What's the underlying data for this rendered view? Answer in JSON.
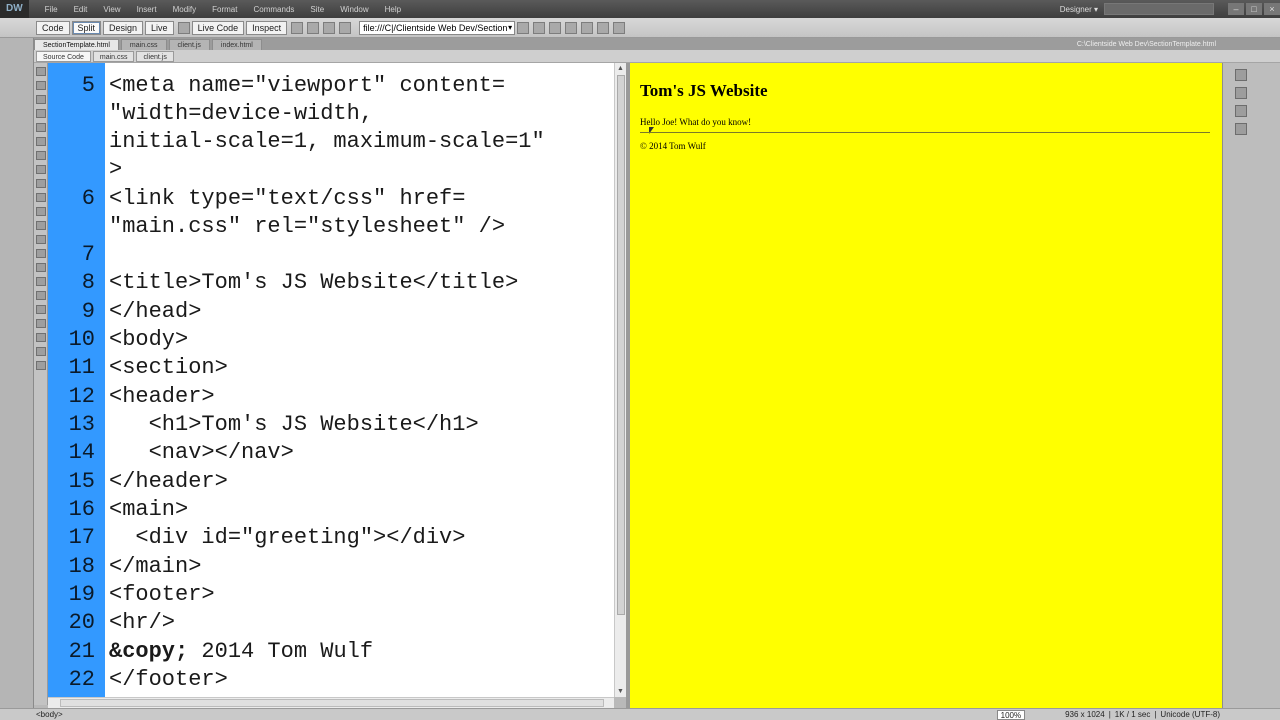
{
  "menubar": {
    "logo": "DW",
    "items": [
      "File",
      "Edit",
      "View",
      "Insert",
      "Modify",
      "Format",
      "Commands",
      "Site",
      "Window",
      "Help"
    ],
    "workspace": "Designer ▾"
  },
  "doc_toolbar": {
    "code_label": "Code",
    "split_label": "Split",
    "design_label": "Design",
    "live_label": "Live",
    "live_code_label": "Live Code",
    "inspect_label": "Inspect",
    "address": "file:///C|/Clientside Web Dev/Section"
  },
  "tabs": [
    {
      "label": "SectionTemplate.html"
    },
    {
      "label": "main.css"
    },
    {
      "label": "client.js"
    },
    {
      "label": "index.html"
    }
  ],
  "file_path": "C:\\Clientside Web Dev\\SectionTemplate.html",
  "related_files": [
    "Source Code",
    "main.css",
    "client.js"
  ],
  "code_lines": [
    {
      "num": "5",
      "text": "<meta name=\"viewport\" content="
    },
    {
      "num": "",
      "text": "\"width=device-width,"
    },
    {
      "num": "",
      "text": "initial-scale=1, maximum-scale=1\""
    },
    {
      "num": "",
      "text": ">"
    },
    {
      "num": "6",
      "text": "<link type=\"text/css\" href="
    },
    {
      "num": "",
      "text": "\"main.css\" rel=\"stylesheet\" />"
    },
    {
      "num": "7",
      "text": ""
    },
    {
      "num": "8",
      "text": "<title>Tom's JS Website</title>"
    },
    {
      "num": "9",
      "text": "</head>"
    },
    {
      "num": "10",
      "text": "<body>"
    },
    {
      "num": "11",
      "text": "<section>"
    },
    {
      "num": "12",
      "text": "<header>"
    },
    {
      "num": "13",
      "text": "   <h1>Tom's JS Website</h1>"
    },
    {
      "num": "14",
      "text": "   <nav></nav>"
    },
    {
      "num": "15",
      "text": "</header>"
    },
    {
      "num": "16",
      "text": "<main>"
    },
    {
      "num": "17",
      "text": "  <div id=\"greeting\"></div>"
    },
    {
      "num": "18",
      "text": "</main>"
    },
    {
      "num": "19",
      "text": "<footer>"
    },
    {
      "num": "20",
      "text": "<hr/>"
    },
    {
      "num": "21",
      "entity": "&copy;",
      "text": " 2014 Tom Wulf"
    },
    {
      "num": "22",
      "text": "</footer>"
    }
  ],
  "design_view": {
    "heading": "Tom's JS Website",
    "greeting": "Hello Joe! What do you know!",
    "footer": "© 2014 Tom Wulf",
    "background": "#ffff00"
  },
  "statusbar": {
    "tag": "<body>",
    "zoom": "100%",
    "size": "936 x 1024",
    "download": "1K / 1 sec",
    "encoding": "Unicode (UTF-8)"
  },
  "colors": {
    "gutter": "#3399ff"
  }
}
